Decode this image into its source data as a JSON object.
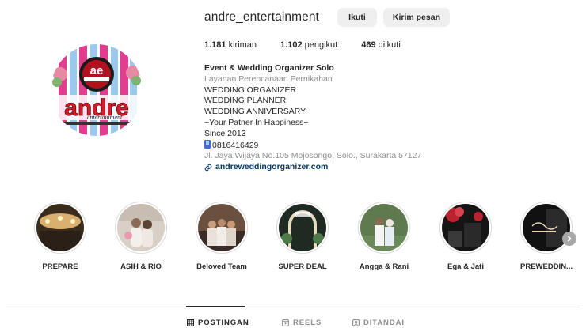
{
  "profile": {
    "username": "andre_entertainment",
    "follow_label": "Ikuti",
    "message_label": "Kirim pesan",
    "avatar_logo_top": "ae",
    "avatar_logo_name": "andre",
    "avatar_logo_sub": "entertainment"
  },
  "stats": [
    {
      "value": "1.181",
      "label": "kiriman"
    },
    {
      "value": "1.102",
      "label": "pengikut"
    },
    {
      "value": "469",
      "label": "diikuti"
    }
  ],
  "bio": {
    "name": "Event & Wedding Organizer Solo",
    "category": "Layanan Perencanaan Pernikahan",
    "lines": [
      "WEDDING ORGANIZER",
      "WEDDING PLANNER",
      "WEDDING ANNIVERSARY",
      "~Your Patner In Happiness~",
      "Since 2013"
    ],
    "phone": "0816416429",
    "address": "Jl. Jaya Wijaya No.105 Mojosongo, Solo., Surakarta 57127",
    "link": "andreweddingorganizer.com"
  },
  "highlights": [
    {
      "label": "PREPARE"
    },
    {
      "label": "ASIH & RIO"
    },
    {
      "label": "Beloved Team"
    },
    {
      "label": "SUPER DEAL"
    },
    {
      "label": "Angga & Rani"
    },
    {
      "label": "Ega & Jati"
    },
    {
      "label": "PREWEDDIN..."
    }
  ],
  "tabs": [
    {
      "label": "POSTINGAN",
      "icon": "grid-icon",
      "active": true
    },
    {
      "label": "REELS",
      "icon": "reels-icon",
      "active": false
    },
    {
      "label": "DITANDAI",
      "icon": "tagged-icon",
      "active": false
    }
  ],
  "colors": {
    "text": "#262626",
    "muted": "#8e8e8e",
    "link": "#00376b",
    "button_bg": "#efefef",
    "logo_red": "#d81b2a"
  }
}
